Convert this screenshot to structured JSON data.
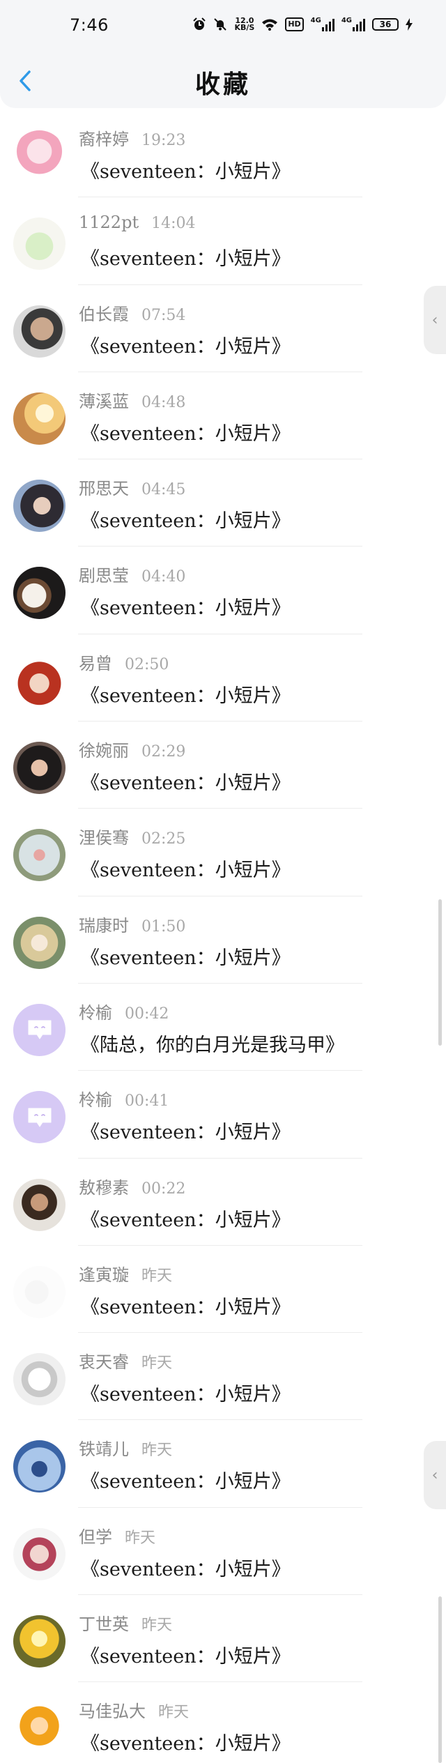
{
  "status_bar": {
    "time": "7:46",
    "net_speed_top": "12.0",
    "net_speed_bottom": "KB/S",
    "hd_label": "HD",
    "signal1_label": "4G",
    "signal2_label": "4G",
    "battery": "36"
  },
  "header": {
    "title": "收藏",
    "back_icon": "chevron-left-icon",
    "accent": "#2f9ae8"
  },
  "items": [
    {
      "name": "裔梓婷",
      "time": "19:23",
      "message": "《seventeen：小短片》",
      "avatar": "pink-anime-cat-girl"
    },
    {
      "name": "1122pt",
      "time": "14:04",
      "message": "《seventeen：小短片》",
      "avatar": "green-bunny-sketch"
    },
    {
      "name": "伯长霞",
      "time": "07:54",
      "message": "《seventeen：小短片》",
      "avatar": "man-portrait"
    },
    {
      "name": "薄溪蓝",
      "time": "04:48",
      "message": "《seventeen：小短片》",
      "avatar": "sunset-photo"
    },
    {
      "name": "邢思天",
      "time": "04:45",
      "message": "《seventeen：小短片》",
      "avatar": "woman-portrait"
    },
    {
      "name": "剧思莹",
      "time": "04:40",
      "message": "《seventeen：小短片》",
      "avatar": "coffee-cup-photo"
    },
    {
      "name": "易曾",
      "time": "02:50",
      "message": "《seventeen：小短片》",
      "avatar": "red-hair-anime"
    },
    {
      "name": "徐婉丽",
      "time": "02:29",
      "message": "《seventeen：小短片》",
      "avatar": "woman-dark-hair"
    },
    {
      "name": "浬侯骞",
      "time": "02:25",
      "message": "《seventeen：小短片》",
      "avatar": "girl-outdoor"
    },
    {
      "name": "瑞康时",
      "time": "01:50",
      "message": "《seventeen：小短片》",
      "avatar": "anime-blonde"
    },
    {
      "name": "柃榆",
      "time": "00:42",
      "message": "《陆总，你的白月光是我马甲》",
      "avatar": "bot-purple"
    },
    {
      "name": "柃榆",
      "time": "00:41",
      "message": "《seventeen：小短片》",
      "avatar": "bot-purple"
    },
    {
      "name": "敖穆素",
      "time": "00:22",
      "message": "《seventeen：小短片》",
      "avatar": "bearded-man"
    },
    {
      "name": "逢寅璇",
      "time": "昨天",
      "message": "《seventeen：小短片》",
      "avatar": "faded-photo"
    },
    {
      "name": "衷天睿",
      "time": "昨天",
      "message": "《seventeen：小短片》",
      "avatar": "cat-sketch"
    },
    {
      "name": "铁靖儿",
      "time": "昨天",
      "message": "《seventeen：小短片》",
      "avatar": "seaside-person"
    },
    {
      "name": "但学",
      "time": "昨天",
      "message": "《seventeen：小短片》",
      "avatar": "couple-photo"
    },
    {
      "name": "丁世英",
      "time": "昨天",
      "message": "《seventeen：小短片》",
      "avatar": "golden-sunset-person"
    },
    {
      "name": "马佳弘大",
      "time": "昨天",
      "message": "《seventeen：小短片》",
      "avatar": "cartoon-girl"
    }
  ],
  "edge_tab_icon": "chevron-left-icon"
}
